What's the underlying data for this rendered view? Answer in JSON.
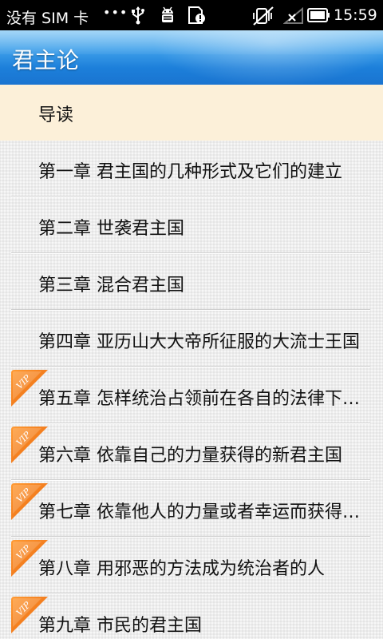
{
  "status_bar": {
    "carrier": "没有 SIM 卡",
    "dots": "•••",
    "time": "15:59",
    "icons": [
      "usb-icon",
      "android-debug-icon",
      "sd-card-alert-icon",
      "silent-mode-icon",
      "no-signal-icon",
      "battery-icon"
    ]
  },
  "app": {
    "title": "君主论"
  },
  "chapters": [
    {
      "label": "导读",
      "vip": false,
      "highlighted": true
    },
    {
      "label": "第一章 君主国的几种形式及它们的建立",
      "vip": false,
      "highlighted": false
    },
    {
      "label": "第二章 世袭君主国",
      "vip": false,
      "highlighted": false
    },
    {
      "label": "第三章 混合君主国",
      "vip": false,
      "highlighted": false
    },
    {
      "label": "第四章 亚历山大大帝所征服的大流士王国",
      "vip": false,
      "highlighted": false
    },
    {
      "label": "第五章 怎样统治占领前在各自的法律下生活的城市或君主国",
      "vip": true,
      "highlighted": false
    },
    {
      "label": "第六章 依靠自己的力量获得的新君主国",
      "vip": true,
      "highlighted": false
    },
    {
      "label": "第七章 依靠他人的力量或者幸运而获得的新君主国",
      "vip": true,
      "highlighted": false
    },
    {
      "label": "第八章 用邪恶的方法成为统治者的人",
      "vip": true,
      "highlighted": false
    },
    {
      "label": "第九章 市民的君主国",
      "vip": true,
      "highlighted": false
    }
  ],
  "vip_badge_text": "VIP",
  "colors": {
    "title_bar": "#1c7fda",
    "highlight_row": "#fcf0d9",
    "vip_badge": "#f07a12"
  }
}
